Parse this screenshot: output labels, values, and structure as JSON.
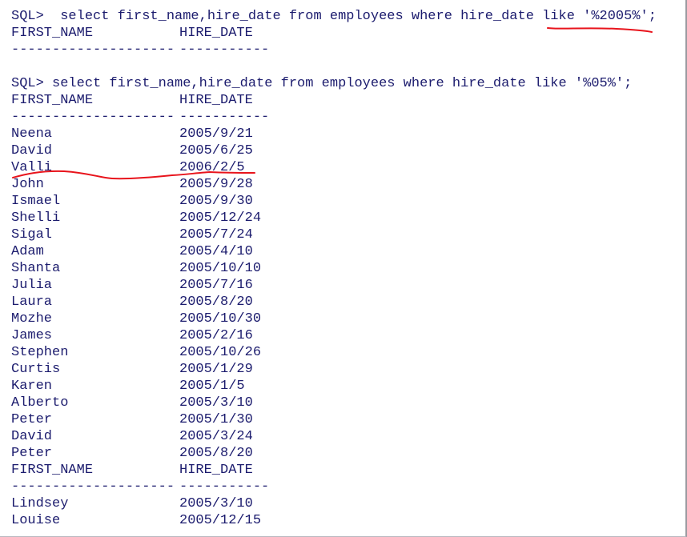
{
  "console": {
    "query1": {
      "command": "SQL>  select first_name,hire_date from employees where hire_date like '%2005%';",
      "header": [
        "FIRST_NAME",
        "HIRE_DATE"
      ],
      "separator": [
        "--------------------",
        "-----------"
      ]
    },
    "query2": {
      "command": "SQL> select first_name,hire_date from employees where hire_date like '%05%';",
      "header": [
        "FIRST_NAME",
        "HIRE_DATE"
      ],
      "separator": [
        "--------------------",
        "-----------"
      ],
      "rows": [
        {
          "first_name": "Neena",
          "hire_date": "2005/9/21"
        },
        {
          "first_name": "David",
          "hire_date": "2005/6/25"
        },
        {
          "first_name": "Valli",
          "hire_date": "2006/2/5"
        },
        {
          "first_name": "John",
          "hire_date": "2005/9/28"
        },
        {
          "first_name": "Ismael",
          "hire_date": "2005/9/30"
        },
        {
          "first_name": "Shelli",
          "hire_date": "2005/12/24"
        },
        {
          "first_name": "Sigal",
          "hire_date": "2005/7/24"
        },
        {
          "first_name": "Adam",
          "hire_date": "2005/4/10"
        },
        {
          "first_name": "Shanta",
          "hire_date": "2005/10/10"
        },
        {
          "first_name": "Julia",
          "hire_date": "2005/7/16"
        },
        {
          "first_name": "Laura",
          "hire_date": "2005/8/20"
        },
        {
          "first_name": "Mozhe",
          "hire_date": "2005/10/30"
        },
        {
          "first_name": "James",
          "hire_date": "2005/2/16"
        },
        {
          "first_name": "Stephen",
          "hire_date": "2005/10/26"
        },
        {
          "first_name": "Curtis",
          "hire_date": "2005/1/29"
        },
        {
          "first_name": "Karen",
          "hire_date": "2005/1/5"
        },
        {
          "first_name": "Alberto",
          "hire_date": "2005/3/10"
        },
        {
          "first_name": "Peter",
          "hire_date": "2005/1/30"
        },
        {
          "first_name": "David",
          "hire_date": "2005/3/24"
        },
        {
          "first_name": "Peter",
          "hire_date": "2005/8/20"
        }
      ],
      "page2_header": [
        "FIRST_NAME",
        "HIRE_DATE"
      ],
      "page2_separator": [
        "--------------------",
        "-----------"
      ],
      "page2_rows": [
        {
          "first_name": "Lindsey",
          "hire_date": "2005/3/10"
        },
        {
          "first_name": "Louise",
          "hire_date": "2005/12/15"
        }
      ]
    }
  },
  "colors": {
    "text": "#1c1c6e",
    "annotation": "#e8141c",
    "background": "#ffffff"
  }
}
